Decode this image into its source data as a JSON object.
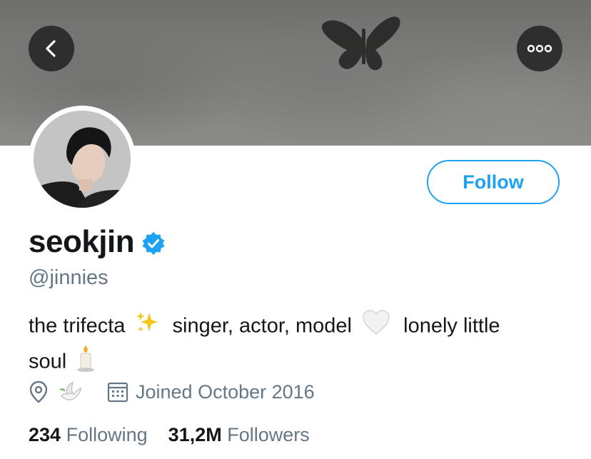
{
  "header": {
    "back_icon": "chevron-left-icon",
    "more_icon": "more-horizontal-icon"
  },
  "profile": {
    "display_name": "seokjin",
    "verified_icon": "verified-badge-icon",
    "handle": "@jinnies",
    "follow_label": "Follow",
    "bio_segments": [
      "the trifecta",
      "singer, actor, model",
      "lonely little",
      "soul"
    ],
    "bio_emojis": [
      "sparkles-icon",
      "white-heart-icon",
      "candle-icon"
    ],
    "location_icon": "location-pin-icon",
    "location_emoji": "dove-icon",
    "calendar_icon": "calendar-icon",
    "joined": "Joined October 2016"
  },
  "stats": {
    "following_count": "234",
    "following_label": "Following",
    "followers_count": "31,2M",
    "followers_label": "Followers"
  },
  "colors": {
    "accent": "#1da1f2",
    "text_primary": "#14171a",
    "text_secondary": "#657786"
  }
}
